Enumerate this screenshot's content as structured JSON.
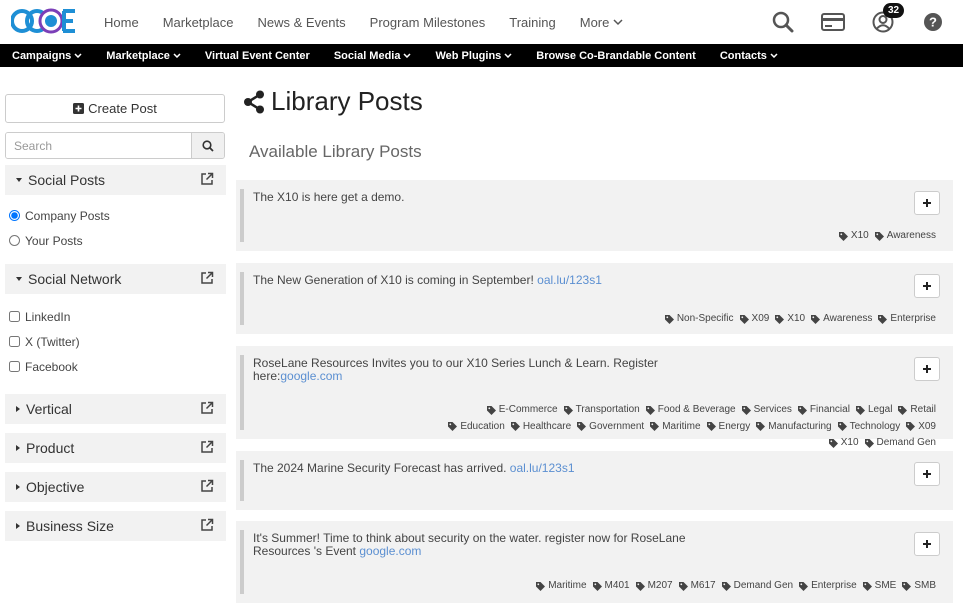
{
  "app": {
    "logo_text": "CCOE"
  },
  "topnav": {
    "links": [
      "Home",
      "Marketplace",
      "News & Events",
      "Program Milestones",
      "Training",
      "More"
    ],
    "notifications_count": "32"
  },
  "subnav": {
    "items": [
      {
        "label": "Campaigns",
        "dropdown": true
      },
      {
        "label": "Marketplace",
        "dropdown": true
      },
      {
        "label": "Virtual Event Center",
        "dropdown": false
      },
      {
        "label": "Social Media",
        "dropdown": true
      },
      {
        "label": "Web Plugins",
        "dropdown": true
      },
      {
        "label": "Browse Co-Brandable Content",
        "dropdown": false
      },
      {
        "label": "Contacts",
        "dropdown": true
      }
    ]
  },
  "sidebar": {
    "create_label": "Create Post",
    "search_placeholder": "Search",
    "social_posts": {
      "title": "Social Posts",
      "options": [
        "Company Posts",
        "Your Posts"
      ],
      "selected": "Company Posts"
    },
    "social_network": {
      "title": "Social Network",
      "options": [
        "LinkedIn",
        "X (Twitter)",
        "Facebook"
      ]
    },
    "collapsed_panels": [
      "Vertical",
      "Product",
      "Objective",
      "Business Size"
    ]
  },
  "main": {
    "title": "Library Posts",
    "subtitle": "Available Library Posts",
    "posts": [
      {
        "text": "The X10 is here  get a demo.",
        "link": "",
        "tags": [
          "X10",
          "Awareness"
        ]
      },
      {
        "text": "The New Generation of X10 is coming in September! ",
        "link": "oal.lu/123s1",
        "tags": [
          "Non-Specific",
          "X09",
          "X10",
          "Awareness",
          "Enterprise"
        ]
      },
      {
        "text": "RoseLane Resources Invites you to our X10 Series Lunch & Learn. Register here:",
        "link": "google.com",
        "tags": [
          "E-Commerce",
          "Transportation",
          "Food & Beverage",
          "Services",
          "Financial",
          "Legal",
          "Retail",
          "Education",
          "Healthcare",
          "Government",
          "Maritime",
          "Energy",
          "Manufacturing",
          "Technology",
          "X09",
          "X10",
          "Demand Gen"
        ]
      },
      {
        "text": "The 2024 Marine Security Forecast has arrived. ",
        "link": "oal.lu/123s1",
        "tags": []
      },
      {
        "text": "It's Summer! Time to think about security on the water. register now for RoseLane Resources 's Event ",
        "link": "google.com",
        "tags": [
          "Maritime",
          "M401",
          "M207",
          "M617",
          "Demand Gen",
          "Enterprise",
          "SME",
          "SMB"
        ]
      }
    ]
  },
  "colors": {
    "link": "#5b8fd1",
    "subnav_bg": "#000000",
    "panel_bg": "#f2f2f2",
    "radio_accent": "#1a73e8"
  }
}
